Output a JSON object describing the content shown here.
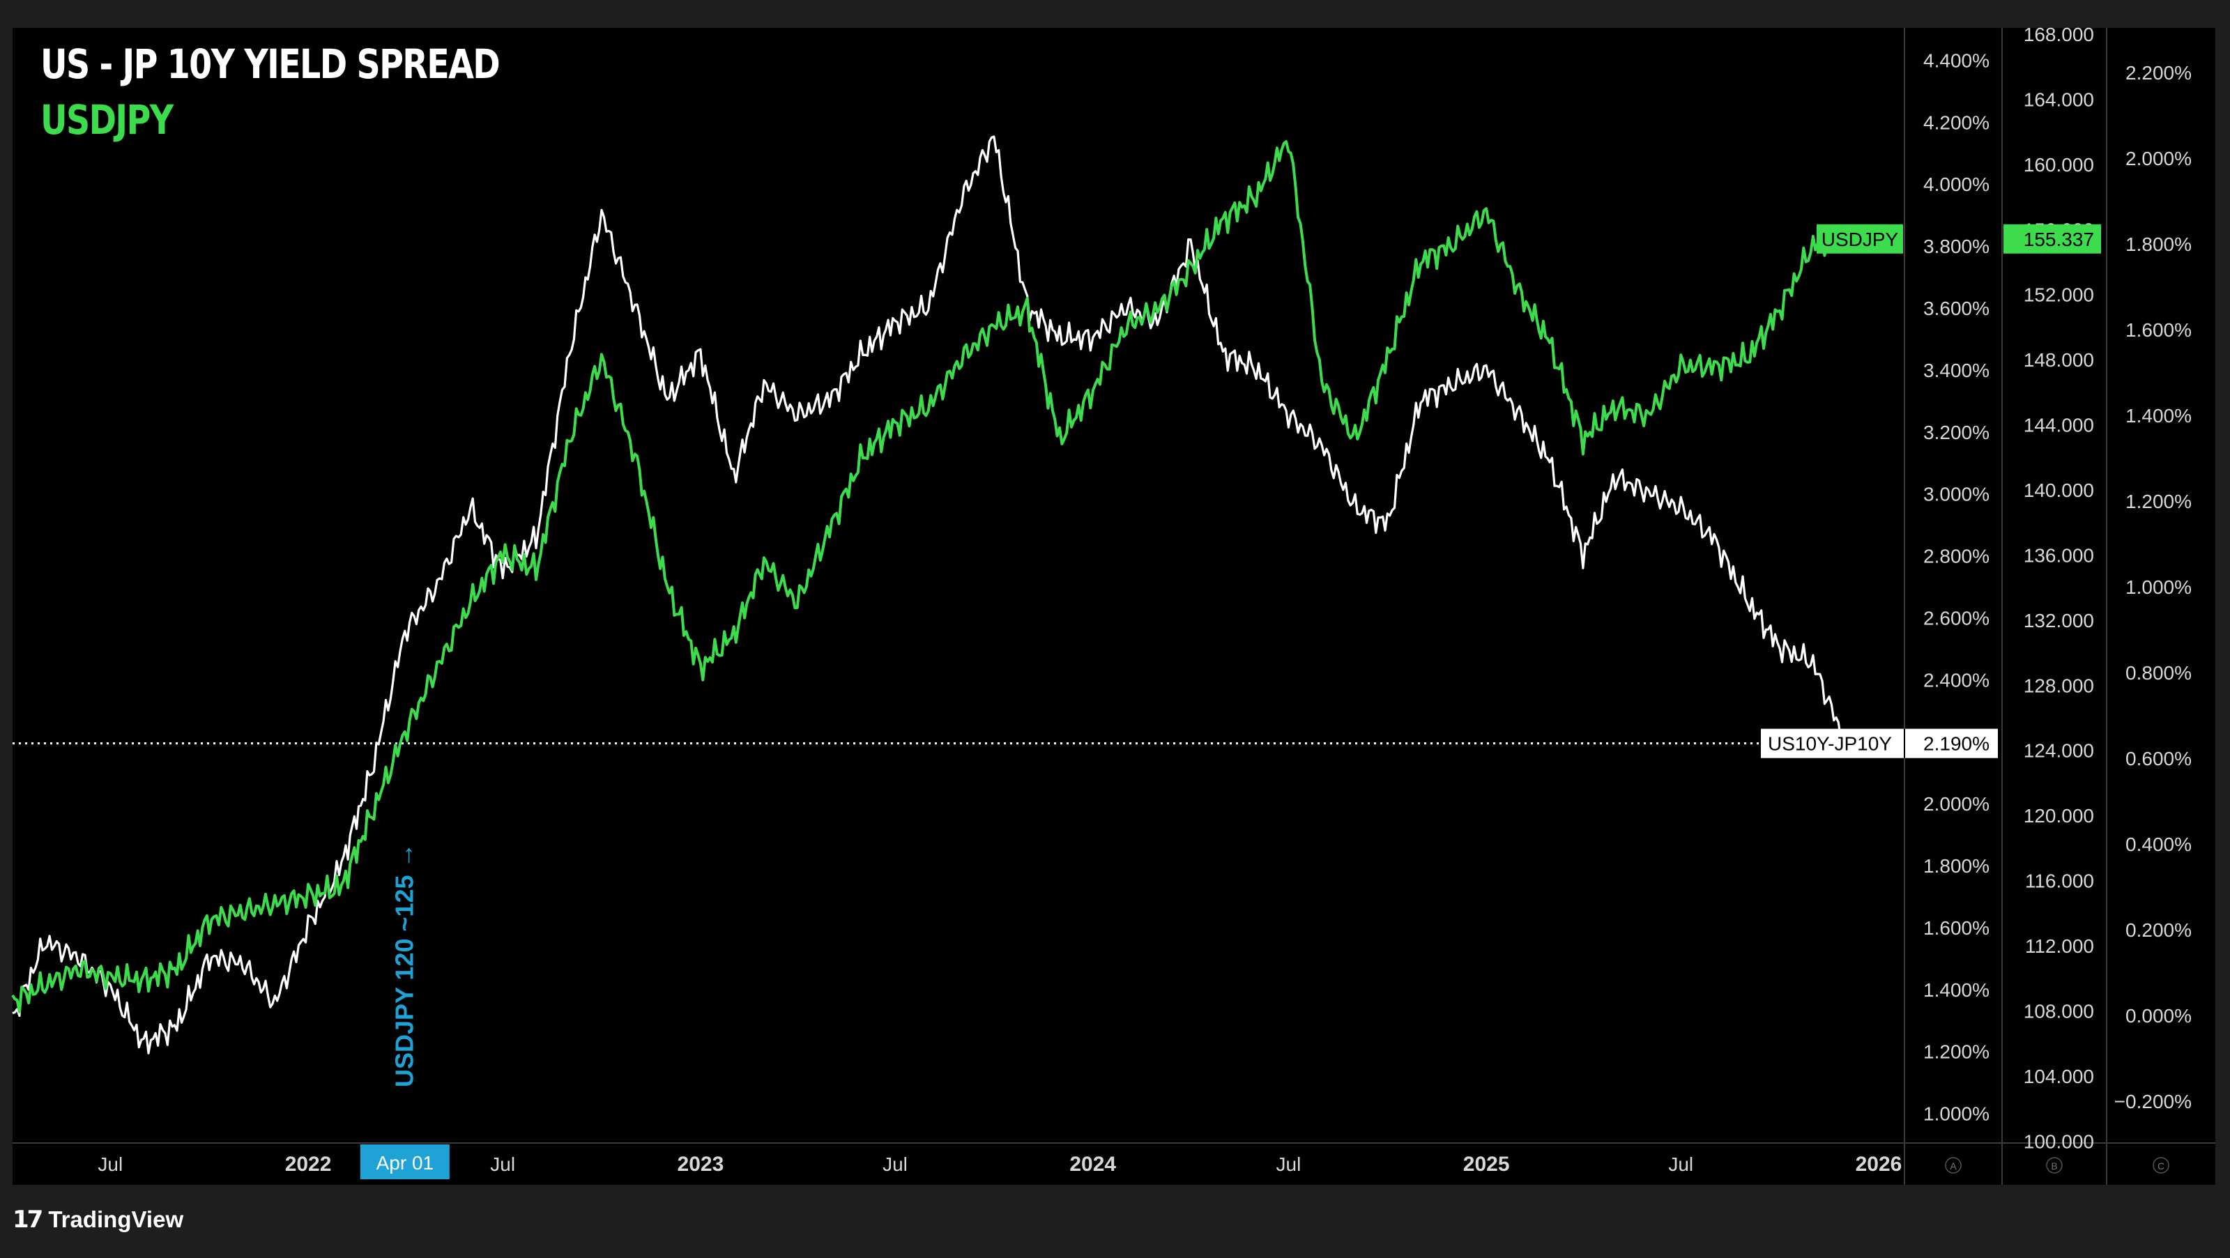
{
  "colors": {
    "background": "#000000",
    "frame": "#1e1e1f",
    "spread_line": "#ffffff",
    "usdjpy_line": "#3ddc4c",
    "annotation": "#1fa3d6",
    "axis_text": "#d8d8d8",
    "axis_divider": "#3a3a3a"
  },
  "header": {
    "title": "US - JP 10Y YIELD SPREAD",
    "subtitle": "USDJPY"
  },
  "branding": {
    "icon": "tradingview-logo-icon",
    "name": "TradingView"
  },
  "chart_data": {
    "type": "line",
    "x_axis": {
      "ticks": [
        {
          "label": "Jul",
          "date": "2021-07-01"
        },
        {
          "label": "2022",
          "date": "2022-01-01"
        },
        {
          "label": "Jul",
          "date": "2022-07-01"
        },
        {
          "label": "2023",
          "date": "2023-01-01"
        },
        {
          "label": "Jul",
          "date": "2023-07-01"
        },
        {
          "label": "2024",
          "date": "2024-01-01"
        },
        {
          "label": "Jul",
          "date": "2024-07-01"
        },
        {
          "label": "2025",
          "date": "2025-01-01"
        },
        {
          "label": "Jul",
          "date": "2025-07-01"
        },
        {
          "label": "2026",
          "date": "2026-01-01"
        }
      ],
      "range": [
        "2021-04-01",
        "2026-01-25"
      ],
      "highlight_label": "Apr 01",
      "highlight_date": "2022-04-01"
    },
    "axis_a": {
      "ticks": [
        "4.400%",
        "4.200%",
        "4.000%",
        "3.800%",
        "3.600%",
        "3.400%",
        "3.200%",
        "3.000%",
        "2.800%",
        "2.600%",
        "2.400%",
        "2.200%",
        "2.000%",
        "1.800%",
        "1.600%",
        "1.400%",
        "1.200%",
        "1.000%"
      ],
      "range": [
        0.9,
        4.5
      ],
      "footer_label": "A"
    },
    "axis_b": {
      "ticks": [
        "168.000",
        "164.000",
        "160.000",
        "156.000",
        "152.000",
        "148.000",
        "144.000",
        "140.000",
        "136.000",
        "132.000",
        "128.000",
        "124.000",
        "120.000",
        "116.000",
        "112.000",
        "108.000",
        "104.000",
        "100.000"
      ],
      "range": [
        99.8,
        168.3
      ],
      "footer_label": "B"
    },
    "axis_c": {
      "ticks": [
        "2.200%",
        "2.000%",
        "1.800%",
        "1.600%",
        "1.400%",
        "1.200%",
        "1.000%",
        "0.800%",
        "0.600%",
        "0.400%",
        "0.200%",
        "0.000%",
        "−0.200%"
      ],
      "footer_label": "C"
    },
    "series": [
      {
        "name": "US10Y-JP10Y",
        "axis": "A",
        "last_value": 2.19,
        "last_value_label": "2.190%",
        "dates": [
          "2021-04-01",
          "2021-05-01",
          "2021-06-01",
          "2021-07-01",
          "2021-08-01",
          "2021-09-01",
          "2021-10-01",
          "2021-11-01",
          "2021-12-01",
          "2022-01-01",
          "2022-02-01",
          "2022-03-01",
          "2022-04-01",
          "2022-05-01",
          "2022-06-01",
          "2022-07-01",
          "2022-08-01",
          "2022-09-01",
          "2022-10-01",
          "2022-11-01",
          "2022-12-01",
          "2023-01-01",
          "2023-02-01",
          "2023-03-01",
          "2023-04-01",
          "2023-05-01",
          "2023-06-01",
          "2023-07-01",
          "2023-08-01",
          "2023-09-01",
          "2023-10-01",
          "2023-11-01",
          "2023-12-01",
          "2024-01-01",
          "2024-02-01",
          "2024-03-01",
          "2024-04-01",
          "2024-05-01",
          "2024-06-01",
          "2024-07-01",
          "2024-08-01",
          "2024-09-01",
          "2024-10-01",
          "2024-11-01",
          "2024-12-01",
          "2025-01-01",
          "2025-02-01",
          "2025-03-01",
          "2025-04-01",
          "2025-05-01",
          "2025-06-01",
          "2025-07-01",
          "2025-08-01",
          "2025-09-01",
          "2025-10-01",
          "2025-11-01",
          "2025-12-01"
        ],
        "values": [
          1.3,
          1.55,
          1.5,
          1.4,
          1.22,
          1.28,
          1.5,
          1.48,
          1.35,
          1.6,
          1.8,
          2.1,
          2.55,
          2.7,
          2.95,
          2.75,
          2.85,
          3.45,
          3.9,
          3.6,
          3.3,
          3.45,
          3.05,
          3.35,
          3.25,
          3.3,
          3.45,
          3.55,
          3.6,
          3.95,
          4.15,
          3.6,
          3.5,
          3.5,
          3.6,
          3.55,
          3.8,
          3.45,
          3.4,
          3.25,
          3.15,
          2.95,
          2.9,
          3.3,
          3.35,
          3.4,
          3.25,
          3.1,
          2.8,
          3.05,
          3.0,
          2.95,
          2.85,
          2.65,
          2.5,
          2.45,
          2.19
        ]
      },
      {
        "name": "USDJPY",
        "axis": "B",
        "last_value": 155.337,
        "last_value_label": "155.337",
        "dates": [
          "2021-04-01",
          "2021-05-01",
          "2021-06-01",
          "2021-07-01",
          "2021-08-01",
          "2021-09-01",
          "2021-10-01",
          "2021-11-01",
          "2021-12-01",
          "2022-01-01",
          "2022-02-01",
          "2022-03-01",
          "2022-04-01",
          "2022-05-01",
          "2022-06-01",
          "2022-07-01",
          "2022-08-01",
          "2022-09-01",
          "2022-10-01",
          "2022-11-01",
          "2022-12-01",
          "2023-01-01",
          "2023-02-01",
          "2023-03-01",
          "2023-04-01",
          "2023-05-01",
          "2023-06-01",
          "2023-07-01",
          "2023-08-01",
          "2023-09-01",
          "2023-10-01",
          "2023-11-01",
          "2023-12-01",
          "2024-01-01",
          "2024-02-01",
          "2024-03-01",
          "2024-04-01",
          "2024-05-01",
          "2024-06-01",
          "2024-07-01",
          "2024-08-01",
          "2024-09-01",
          "2024-10-01",
          "2024-11-01",
          "2024-12-01",
          "2025-01-01",
          "2025-02-01",
          "2025-03-01",
          "2025-04-01",
          "2025-05-01",
          "2025-06-01",
          "2025-07-01",
          "2025-08-01",
          "2025-09-01",
          "2025-10-01",
          "2025-11-01",
          "2025-12-01"
        ],
        "values": [
          108.5,
          109.5,
          110.5,
          110.0,
          109.8,
          110.5,
          113.5,
          114.0,
          114.5,
          115.0,
          115.5,
          120.0,
          125.0,
          129.0,
          133.0,
          136.0,
          135.0,
          143.0,
          148.0,
          142.0,
          134.0,
          129.0,
          131.0,
          135.5,
          133.0,
          137.5,
          142.0,
          144.0,
          145.0,
          148.0,
          150.0,
          151.0,
          143.0,
          146.0,
          150.0,
          151.0,
          153.5,
          156.5,
          158.0,
          161.5,
          146.5,
          143.0,
          148.0,
          154.0,
          155.0,
          157.0,
          152.0,
          149.0,
          143.0,
          145.0,
          144.5,
          147.5,
          147.5,
          148.0,
          151.0,
          155.0,
          155.3
        ]
      }
    ],
    "annotations": [
      {
        "text": "USDJPY 120 ~125 →",
        "date": "2022-03-20"
      }
    ],
    "reference_line": {
      "value": 2.19,
      "axis": "A",
      "style": "dotted"
    }
  }
}
